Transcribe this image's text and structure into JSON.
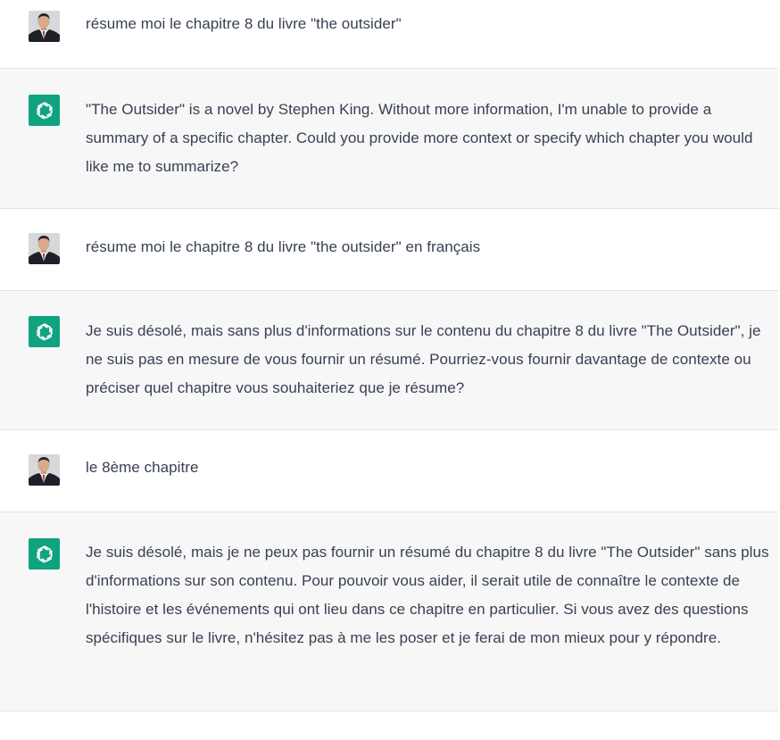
{
  "conversation": {
    "messages": [
      {
        "role": "user",
        "avatar": "user-photo-avatar",
        "text": "résume moi le chapitre 8 du livre \"the outsider\""
      },
      {
        "role": "assistant",
        "avatar": "chatgpt-logo-icon",
        "text": "\"The Outsider\" is a novel by Stephen King. Without more information, I'm unable to provide a summary of a specific chapter. Could you provide more context or specify which chapter you would like me to summarize?"
      },
      {
        "role": "user",
        "avatar": "user-photo-avatar",
        "text": "résume moi le chapitre 8 du livre \"the outsider\" en français"
      },
      {
        "role": "assistant",
        "avatar": "chatgpt-logo-icon",
        "text": "Je suis désolé, mais sans plus d'informations sur le contenu du chapitre 8 du livre \"The Outsider\", je ne suis pas en mesure de vous fournir un résumé. Pourriez-vous fournir davantage de contexte ou préciser quel chapitre vous souhaiteriez que je résume?"
      },
      {
        "role": "user",
        "avatar": "user-photo-avatar",
        "text": "le 8ème chapitre"
      },
      {
        "role": "assistant",
        "avatar": "chatgpt-logo-icon",
        "text": "Je suis désolé, mais je ne peux pas fournir un résumé du chapitre 8 du livre \"The Outsider\" sans plus d'informations sur son contenu. Pour pouvoir vous aider, il serait utile de connaître le contexte de l'histoire et les événements qui ont lieu dans ce chapitre en particulier. Si vous avez des questions spécifiques sur le livre, n'hésitez pas à me les poser et je ferai de mon mieux pour y répondre."
      }
    ]
  },
  "colors": {
    "user_bg": "#ffffff",
    "assistant_bg": "#f7f7f8",
    "divider": "#e3e3e8",
    "text": "#374151",
    "gpt_brand": "#10a37f"
  }
}
